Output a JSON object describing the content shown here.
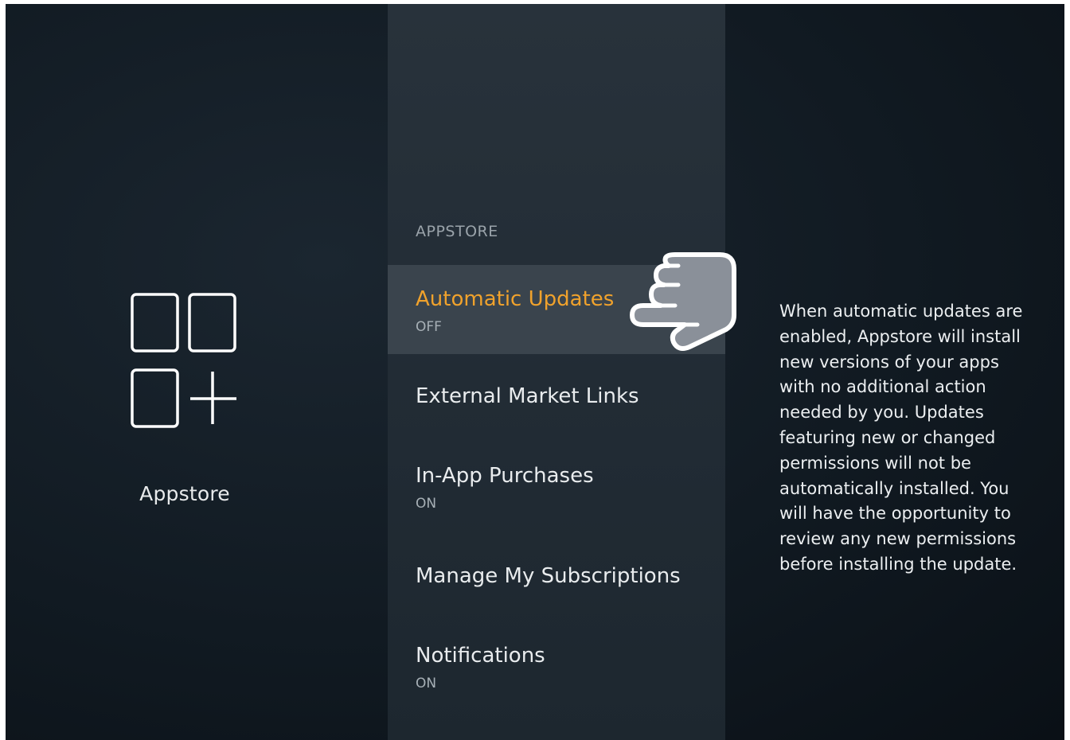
{
  "app": {
    "name": "Appstore",
    "icon": "appstore-grid-plus-icon"
  },
  "menu": {
    "section_title": "APPSTORE",
    "items": [
      {
        "label": "Automatic Updates",
        "value": "OFF",
        "selected": true
      },
      {
        "label": "External Market Links",
        "value": ""
      },
      {
        "label": "In-App Purchases",
        "value": "ON"
      },
      {
        "label": "Manage My Subscriptions",
        "value": ""
      },
      {
        "label": "Notifications",
        "value": "ON"
      }
    ]
  },
  "description": "When automatic updates are enabled, Appstore will install new versions of your apps with no additional action needed by you. Updates featuring new or changed permissions will not be automatically installed. You will have the opportunity to review any new permissions before installing the update.",
  "overlay": {
    "icon": "pointing-hand-icon"
  },
  "colors": {
    "accent": "#f0a22c",
    "selected_bg": "#3a444d",
    "panel_bg": "#242e37"
  }
}
